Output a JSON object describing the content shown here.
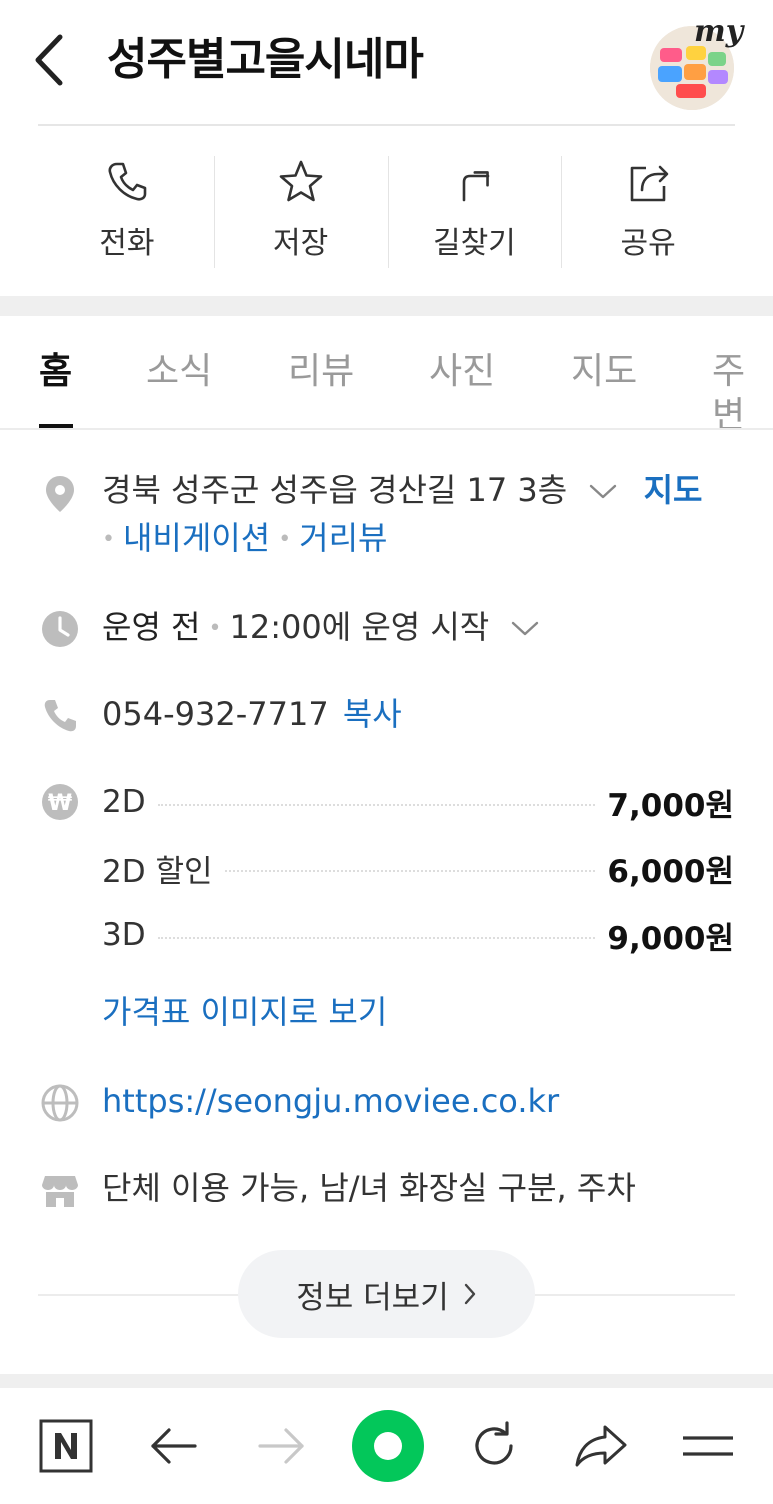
{
  "header": {
    "title": "성주별고을시네마",
    "avatar_text": "my"
  },
  "actions": [
    {
      "label": "전화",
      "icon": "phone-icon"
    },
    {
      "label": "저장",
      "icon": "star-icon"
    },
    {
      "label": "길찾기",
      "icon": "directions-icon"
    },
    {
      "label": "공유",
      "icon": "share-icon"
    }
  ],
  "tabs": [
    {
      "label": "홈",
      "active": true
    },
    {
      "label": "소식"
    },
    {
      "label": "리뷰"
    },
    {
      "label": "사진"
    },
    {
      "label": "지도"
    },
    {
      "label": "주변"
    }
  ],
  "address": {
    "text": "경북 성주군 성주읍 경산길 17 3층",
    "map_link": "지도",
    "navigation_link": "내비게이션",
    "streetview_link": "거리뷰"
  },
  "hours": {
    "status": "운영 전",
    "detail": "12:00에 운영 시작"
  },
  "phone": {
    "number": "054-932-7717",
    "copy_label": "복사"
  },
  "prices": [
    {
      "label": "2D",
      "value": "7,000원"
    },
    {
      "label": "2D 할인",
      "value": "6,000원"
    },
    {
      "label": "3D",
      "value": "9,000원"
    }
  ],
  "price_image_link": "가격표 이미지로 보기",
  "website": "https://seongju.moviee.co.kr",
  "amenities": "단체 이용 가능, 남/녀 화장실 구분, 주차",
  "more_button": "정보 더보기",
  "colors": {
    "link": "#1a6fc0",
    "brand_green": "#03c75a",
    "icon_gray": "#bdbdbd"
  }
}
